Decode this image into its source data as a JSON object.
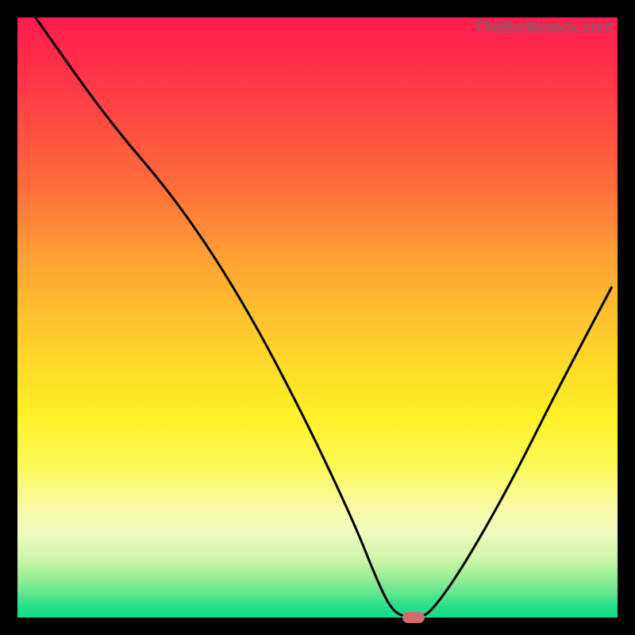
{
  "watermark": "TheBottleneck.com",
  "chart_data": {
    "type": "line",
    "title": "",
    "xlabel": "",
    "ylabel": "",
    "xlim": [
      0,
      100
    ],
    "ylim": [
      0,
      100
    ],
    "x": [
      3,
      15,
      27,
      38,
      48,
      56,
      60,
      62.5,
      65,
      67,
      69,
      74,
      82,
      90,
      99
    ],
    "values": [
      100,
      83,
      69,
      52,
      33,
      16,
      6,
      1,
      0,
      0,
      1,
      8,
      22,
      38,
      55
    ],
    "marker": {
      "x": 66,
      "y": 0
    },
    "background": "vertical-gradient red→orange→yellow→green",
    "frame": "black"
  }
}
